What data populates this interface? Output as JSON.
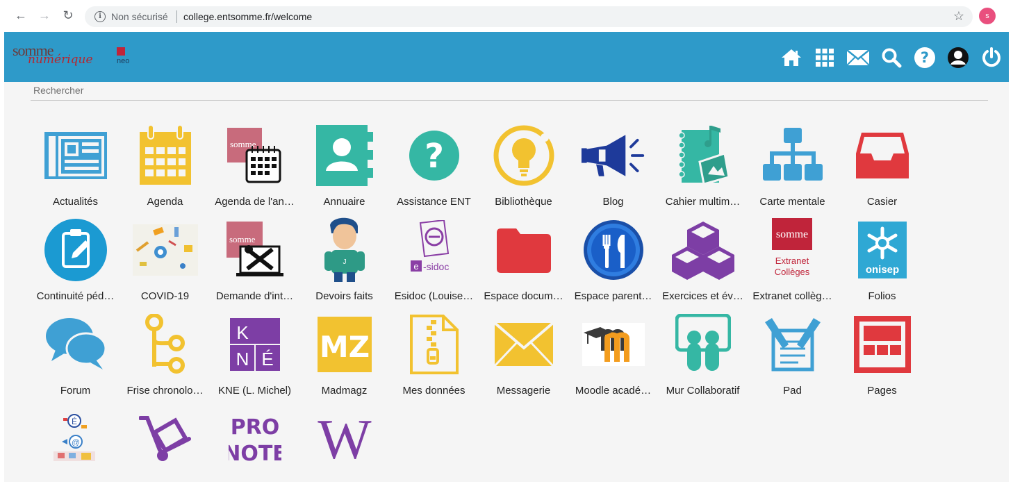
{
  "browser": {
    "security_label": "Non sécurisé",
    "url": "college.entsomme.fr/welcome",
    "profile_initial": "s"
  },
  "header": {
    "logo_somme": "somme",
    "logo_numerique": "numérique",
    "logo_neo": "neo",
    "icons": [
      "home-icon",
      "apps-grid-icon",
      "mail-icon",
      "search-icon",
      "help-icon",
      "user-icon",
      "power-icon"
    ]
  },
  "search": {
    "placeholder": "Rechercher"
  },
  "apps": [
    {
      "label": "Actualités",
      "icon": "newspaper-icon"
    },
    {
      "label": "Agenda",
      "icon": "calendar-icon"
    },
    {
      "label": "Agenda de l'an…",
      "icon": "year-calendar-icon"
    },
    {
      "label": "Annuaire",
      "icon": "contacts-book-icon"
    },
    {
      "label": "Assistance ENT",
      "icon": "help-circle-icon"
    },
    {
      "label": "Bibliothèque",
      "icon": "lightbulb-icon"
    },
    {
      "label": "Blog",
      "icon": "megaphone-icon"
    },
    {
      "label": "Cahier multim…",
      "icon": "notebook-icon"
    },
    {
      "label": "Carte mentale",
      "icon": "mindmap-icon"
    },
    {
      "label": "Casier",
      "icon": "inbox-tray-icon"
    },
    {
      "label": "Continuité péd…",
      "icon": "clipboard-pencil-icon"
    },
    {
      "label": "COVID-19",
      "icon": "school-supplies-icon"
    },
    {
      "label": "Demande d'int…",
      "icon": "repair-tools-icon"
    },
    {
      "label": "Devoirs faits",
      "icon": "student-character-icon"
    },
    {
      "label": "Esidoc (Louise…",
      "icon": "esidoc-icon"
    },
    {
      "label": "Espace docum…",
      "icon": "folder-icon"
    },
    {
      "label": "Espace parent…",
      "icon": "restaurant-icon"
    },
    {
      "label": "Exercices et év…",
      "icon": "cubes-icon"
    },
    {
      "label": "Extranet collèg…",
      "icon": "extranet-logo-icon"
    },
    {
      "label": "Folios",
      "icon": "onisep-icon"
    },
    {
      "label": "Forum",
      "icon": "speech-bubbles-icon"
    },
    {
      "label": "Frise chronolo…",
      "icon": "timeline-icon"
    },
    {
      "label": "KNE (L. Michel)",
      "icon": "kne-icon"
    },
    {
      "label": "Madmagz",
      "icon": "madmagz-icon"
    },
    {
      "label": "Mes données",
      "icon": "zip-file-icon"
    },
    {
      "label": "Messagerie",
      "icon": "envelope-icon"
    },
    {
      "label": "Moodle acadé…",
      "icon": "moodle-icon"
    },
    {
      "label": "Mur Collaboratif",
      "icon": "collab-wall-icon"
    },
    {
      "label": "Pad",
      "icon": "pad-icon"
    },
    {
      "label": "Pages",
      "icon": "pages-icon"
    },
    {
      "label": "",
      "icon": "mail-network-icon"
    },
    {
      "label": "",
      "icon": "hand-truck-icon"
    },
    {
      "label": "",
      "icon": "pronote-icon"
    },
    {
      "label": "",
      "icon": "wikipedia-icon"
    }
  ],
  "icon_text": {
    "somme": "somme",
    "extranet_line1": "Extranet",
    "extranet_line2": "Collèges",
    "onisep": "onisep",
    "kne_k": "K",
    "kne_n": "N",
    "kne_e": "É",
    "madmagz": "MZ",
    "esidoc": "e-sidoc",
    "pronote_1": "PRO",
    "pronote_2": "NOTE",
    "wiki": "W"
  },
  "colors": {
    "header": "#2e9ac9",
    "content_bg": "#f5f5f5",
    "blue": "#3fa0d4",
    "yellow": "#f2c230",
    "teal": "#35b7a4",
    "red": "#e0393e",
    "purple": "#7d3ea5",
    "navy": "#1e3a9a"
  }
}
